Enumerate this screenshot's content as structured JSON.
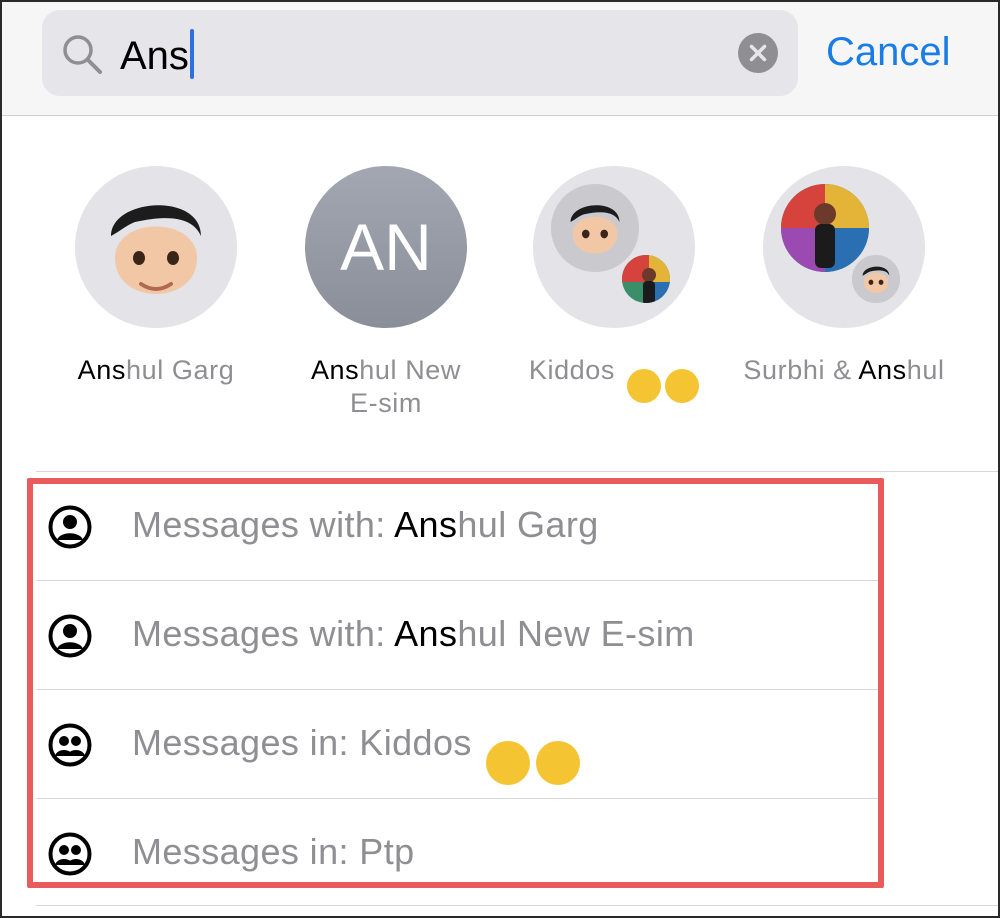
{
  "search": {
    "query": "Ans",
    "cancel_label": "Cancel"
  },
  "contacts": [
    {
      "name_match": "Ans",
      "name_rest": "hul Garg",
      "line2": ""
    },
    {
      "name_match": "Ans",
      "name_rest": "hul New",
      "line2": "E-sim",
      "initials": "AN"
    },
    {
      "name_prefix": "Kiddos",
      "emojis": [
        "😂",
        "🤪"
      ]
    },
    {
      "name_prefix": "Surbhi & ",
      "name_match": "Ans",
      "name_rest": "hul"
    }
  ],
  "results": [
    {
      "prefix": "Messages with: ",
      "match": "Ans",
      "rest": "hul Garg",
      "icon": "person-circle-icon"
    },
    {
      "prefix": "Messages with: ",
      "match": "Ans",
      "rest": "hul New E-sim",
      "icon": "person-circle-icon"
    },
    {
      "prefix": "Messages in: Kiddos ",
      "emojis": [
        "😂",
        "🤪"
      ],
      "icon": "group-circle-icon"
    },
    {
      "prefix": "Messages in: Ptp",
      "icon": "group-circle-icon"
    }
  ],
  "colors": {
    "accent": "#1a7de6",
    "highlight_border": "#ea5b5b",
    "secondary_text": "#8e8e93"
  }
}
